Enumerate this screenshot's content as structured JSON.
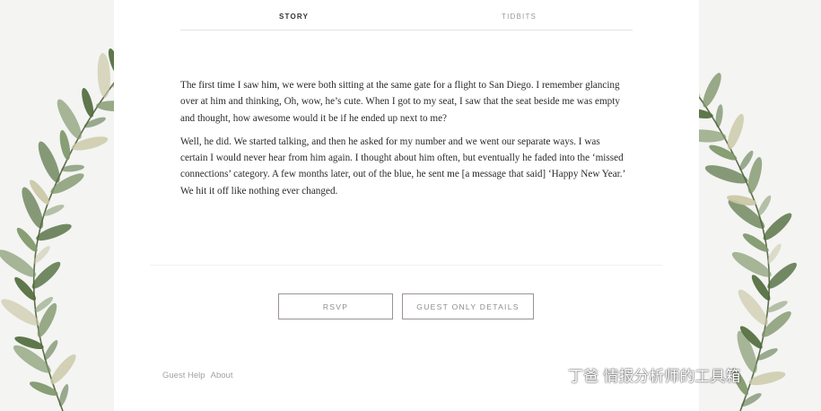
{
  "tabs": [
    {
      "label": "STORY",
      "active": true
    },
    {
      "label": "TIDBITS",
      "active": false
    }
  ],
  "story": {
    "paragraph1": "The first time I saw him, we were both sitting at the same gate for a flight to San Diego. I remember glancing over at him and thinking, Oh, wow, he’s cute. When I got to my seat, I saw that the seat beside me was empty and thought, how awesome would it be if he ended up next to me?",
    "paragraph2": "Well, he did. We started talking, and then he asked for my number and we went our separate ways. I was certain I would never hear from him again. I thought about him often, but eventually he faded into the ‘missed connections’ category. A few months later, out of the blue, he sent me [a message that said] ‘Happy New Year.’ We hit it off like nothing ever changed."
  },
  "buttons": {
    "rsvp": "RSVP",
    "guest_details": "GUEST ONLY DETAILS"
  },
  "footer": {
    "guest_help": "Guest Help",
    "about": "About"
  },
  "watermark": {
    "text": "丁爸 情报分析师的工具箱",
    "icon": "wechat-icon"
  },
  "colors": {
    "leaf_dark": "#4f6b3a",
    "leaf_mid": "#7d9568",
    "leaf_light": "#c9c7a4",
    "button_border": "#9c9393"
  }
}
